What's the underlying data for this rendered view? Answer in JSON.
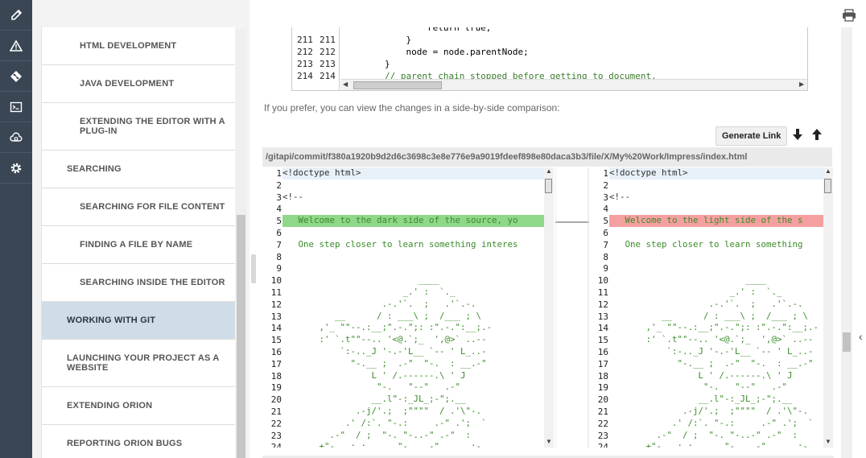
{
  "rail": {
    "icons": [
      "pencil-icon",
      "warning-triangle-icon",
      "git-icon",
      "terminal-icon",
      "cloud-sync-icon",
      "gear-icon"
    ]
  },
  "nav": {
    "items": [
      {
        "label": "HTML DEVELOPMENT",
        "level": 2
      },
      {
        "label": "JAVA DEVELOPMENT",
        "level": 2
      },
      {
        "label": "EXTENDING THE EDITOR WITH A PLUG-IN",
        "level": 2
      },
      {
        "label": "SEARCHING",
        "level": 1
      },
      {
        "label": "SEARCHING FOR FILE CONTENT",
        "level": 2
      },
      {
        "label": "FINDING A FILE BY NAME",
        "level": 2
      },
      {
        "label": "SEARCHING INSIDE THE EDITOR",
        "level": 2
      },
      {
        "label": "WORKING WITH GIT",
        "level": 1,
        "active": true
      },
      {
        "label": "LAUNCHING YOUR PROJECT AS A WEBSITE",
        "level": 1
      },
      {
        "label": "EXTENDING ORION",
        "level": 1
      },
      {
        "label": "REPORTING ORION BUGS",
        "level": 1
      }
    ]
  },
  "top_diff": {
    "rows": [
      {
        "n1": "",
        "n2": "",
        "code": "                return true;",
        "comment": false
      },
      {
        "n1": "211",
        "n2": "211",
        "code": "            }",
        "comment": false
      },
      {
        "n1": "212",
        "n2": "212",
        "code": "            node = node.parentNode;",
        "comment": false
      },
      {
        "n1": "213",
        "n2": "213",
        "code": "        }",
        "comment": false
      },
      {
        "n1": "214",
        "n2": "214",
        "code": "        // parent chain stopped before getting to document.",
        "comment": true
      }
    ]
  },
  "side_note": "If you prefer, you can view the changes in a side-by-side comparison:",
  "toolbar": {
    "generate_link": "Generate Link"
  },
  "path": "/gitapi/commit/f380a1920b9d2d6c3698c3e8e776e9a9019fdeef898e80daca3b3/file/X/My%20Work/Impress/index.html",
  "left_lines": [
    "<!doctype html>",
    "",
    "<!--",
    "",
    "   Welcome to the dark side of the source, yo",
    "",
    "   One step closer to learn something interes",
    "",
    "",
    "                          ____",
    "                       _.' :  `._",
    "                   .-.'`.  ;   .'`.-.",
    "          __      / : ___\\ ;  /___ ; \\",
    "       ,'_ \"\"--.:__;\".-.\";: :\".-.\":__;.-",
    "       :' `.t\"\"--.. '<@.`;_  ',@>` ..--",
    "           `:-.._J '-.-'L__ `-- ' L_..-",
    "             \"-.__ ;  .-\"  \"-.  : __.-\"",
    "                 L ' /.------.\\ ' J",
    "                  \"-.   \"--\"   .-\"",
    "                 __.l\"-:_JL_;-\";.__",
    "              .-j/'.;  ;\"\"\"\"  / .'\\\"-.",
    "            .' /:`. \"-.:     .-\" .';  `",
    "         .-\"  / ;  \"-. \"-..-\" .-\"  :",
    "      .+\"-.  : :      \"-.__.-\"      ;-."
  ],
  "right_lines": [
    "<!doctype html>",
    "",
    "<!--",
    "",
    "   Welcome to the light side of the s",
    "",
    "   One step closer to learn something",
    "",
    "",
    "                          ____",
    "                       _.' :  `._",
    "                   .-.'`.  ;   .'`.-.",
    "          __      / : ___\\ ;  /___ ; \\",
    "       ,'_ \"\"--.:__;\".-.\";: :\".-.\":__;.-",
    "       :' `.t\"\"--.. '<@.`;_  ',@>` ..--",
    "           `:-.._J '-.-'L__ `-- ' L_..-",
    "             \"-.__ ;  .-\"  \"-.  : __.-\"",
    "                 L ' /.------.\\ ' J",
    "                  \"-.   \"--\"   .-\"",
    "                 __.l\"-:_JL_;-\";.__",
    "              .-j/'.;  ;\"\"\"\"  / .'\\\"-.",
    "            .' /:`. \"-.:     .-\" .';  `",
    "         .-\"  / ;  \"-. \"-..-\" .-\"  :",
    "      .+\"-.  : :      \"-.__.-\"      ;-."
  ],
  "colors": {
    "rail": "#3a4654",
    "active_nav": "#d0dde8",
    "added": "#8fd88a",
    "removed": "#f5a0a0",
    "highlight": "#ee1d23"
  }
}
